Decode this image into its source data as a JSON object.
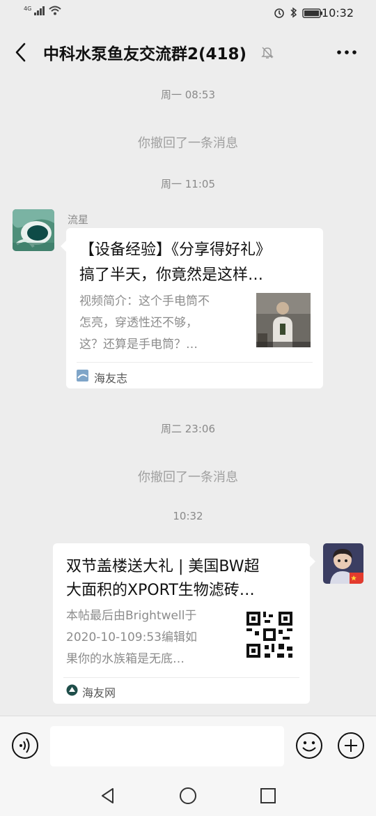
{
  "status_bar": {
    "network": "4G",
    "time": "10:32"
  },
  "header": {
    "title": "中科水泵鱼友交流群2(418)"
  },
  "messages": {
    "ts1": "周一 08:53",
    "recall1": "你撤回了一条消息",
    "ts2": "周一 11:05",
    "sender_name": "流星",
    "card1": {
      "title_line1": "【设备经验】《分享得好礼》",
      "title_line2": "搞了半天，你竟然是这样…",
      "desc_line1": "视频简介：这个手电筒不",
      "desc_line2": "怎亮，穿透性还不够，",
      "desc_line3": "这？还算是手电筒？…",
      "source": "海友志"
    },
    "ts3": "周二 23:06",
    "recall2": "你撤回了一条消息",
    "ts4": "10:32",
    "card2": {
      "title_line1": "双节盖楼送大礼 | 美国BW超",
      "title_line2": "大面积的XPORT生物滤砖…",
      "desc_line1": "本帖最后由Brightwell于",
      "desc_line2": "2020-10-109:53编辑如",
      "desc_line3": "果你的水族箱是无底…",
      "source": "海友网"
    }
  },
  "colors": {
    "background": "#ededed",
    "card": "#ffffff",
    "muted": "#8c8c8c"
  },
  "icons": [
    "back-arrow-icon",
    "mute-bell-icon",
    "more-icon",
    "voice-icon",
    "emoji-icon",
    "plus-icon",
    "nav-back-icon",
    "nav-home-icon",
    "nav-recent-icon"
  ]
}
